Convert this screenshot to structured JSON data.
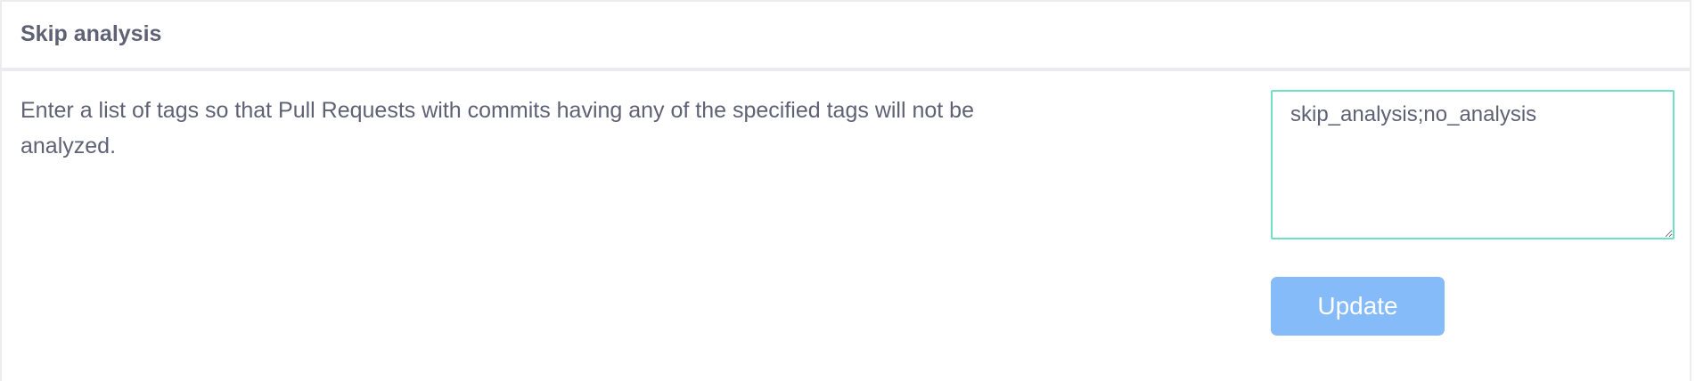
{
  "section": {
    "title": "Skip analysis",
    "description": "Enter a list of tags so that Pull Requests with commits having any of the specified tags will not be analyzed."
  },
  "tags_field": {
    "value": "skip_analysis;no_analysis",
    "border_color": "#6ee0c4"
  },
  "update_button": {
    "label": "Update",
    "color": "#84bbf8",
    "state": "disabled"
  }
}
